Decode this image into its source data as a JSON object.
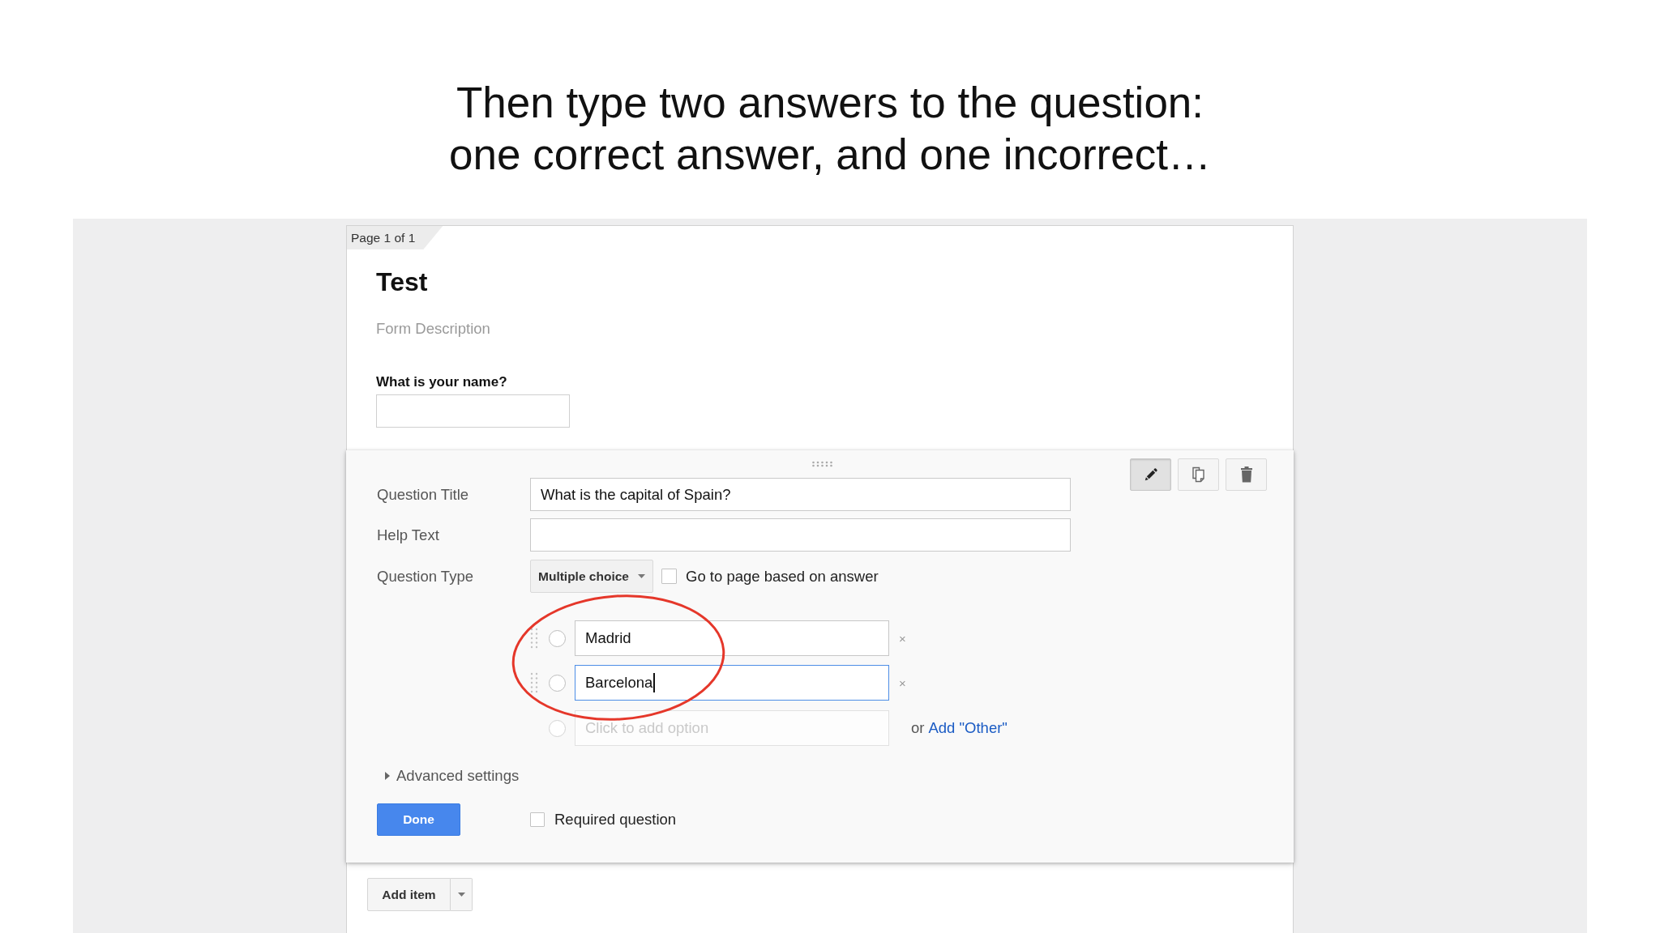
{
  "slide_heading": "Then type two answers to the question:\none correct answer, and one incorrect…",
  "form": {
    "page_indicator": "Page 1 of 1",
    "title": "Test",
    "description": {
      "placeholder": "Form Description"
    },
    "questions": [
      {
        "title": "What is your name?"
      }
    ],
    "editor": {
      "toolbar": [
        {
          "kind": "edit",
          "pressed": true
        },
        {
          "kind": "duplicate",
          "pressed": false
        },
        {
          "kind": "delete",
          "pressed": false
        }
      ],
      "fields": [
        {
          "label": "Question Title",
          "value": "What is the capital of Spain?"
        },
        {
          "label": "Help Text"
        }
      ],
      "question_type": {
        "label": "Question Type",
        "value": "Multiple choice"
      },
      "page_navigation": {
        "label": "Go to page based on answer",
        "checked": false
      },
      "options": [
        {
          "value": "Madrid",
          "selected": false,
          "focused": false,
          "remove": "×"
        },
        {
          "value": "Barcelona",
          "selected": false,
          "focused": true,
          "remove": "×"
        }
      ],
      "new_option": {
        "placeholder": "Click to add option",
        "selected": false,
        "other_prefix": "or",
        "other_link": "Add \"Other\""
      },
      "advanced_settings": {
        "label": "Advanced settings",
        "expanded": false
      },
      "done_button": "Done",
      "required": {
        "label": "Required question",
        "checked": false
      }
    },
    "add_item_button": "Add item"
  }
}
